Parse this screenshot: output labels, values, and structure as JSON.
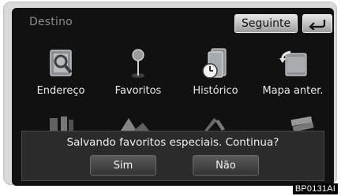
{
  "screen": {
    "title": "Destino"
  },
  "header": {
    "next_label": "Seguinte",
    "back_icon": "return-arrow-icon"
  },
  "menu": {
    "items": [
      {
        "label": "Endereço",
        "icon": "address-book-icon"
      },
      {
        "label": "Favoritos",
        "icon": "favorites-pin-icon"
      },
      {
        "label": "Histórico",
        "icon": "history-clock-icon"
      },
      {
        "label": "Mapa anter.",
        "icon": "previous-map-icon"
      }
    ]
  },
  "dialog": {
    "message": "Salvando favoritos especiais. Continua?",
    "yes_label": "Sim",
    "no_label": "Não"
  },
  "figure_code": "BP0131AI"
}
